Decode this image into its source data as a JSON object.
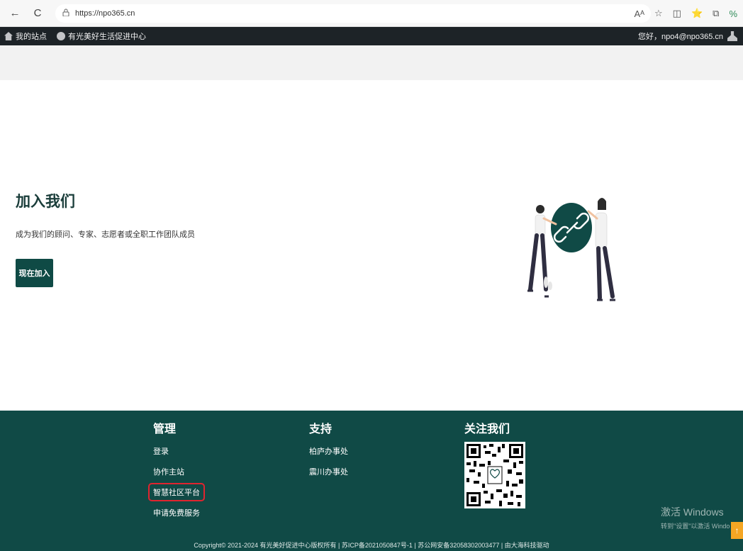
{
  "browser": {
    "url": "https://npo365.cn",
    "back_glyph": "←",
    "reload_glyph": "C",
    "lock_glyph": "🔒",
    "toolbar_icons": [
      "Aᴬ",
      "☆",
      "◫",
      "⭐",
      "⧉",
      "%"
    ]
  },
  "adminbar": {
    "site_label": "我的站点",
    "org_label": "有光美好生活促进中心",
    "greeting": "您好，npo4@npo365.cn"
  },
  "hero": {
    "title": "加入我们",
    "subtitle": "成为我们的顾问、专家、志愿者或全职工作团队成员",
    "join_button": "现在加入"
  },
  "footer": {
    "manage": {
      "title": "管理",
      "links": [
        "登录",
        "协作主站",
        "智慧社区平台",
        "申请免费服务"
      ]
    },
    "support": {
      "title": "支持",
      "links": [
        "柏庐办事处",
        "震川办事处"
      ]
    },
    "follow": {
      "title": "关注我们"
    },
    "copyright": "Copyright© 2021-2024 有光美好促进中心版权所有 | 苏ICP备2021050847号-1 | 苏公网安备32058302003477 | 由大海科技驱动"
  },
  "watermark": {
    "line1": "激活 Windows",
    "line2": "转到\"设置\"以激活 Windo"
  },
  "scroll_top_glyph": "↑",
  "colors": {
    "primary": "#104a46",
    "button": "#0f4a45",
    "highlight": "#e0242f",
    "accent": "#f5a623"
  }
}
